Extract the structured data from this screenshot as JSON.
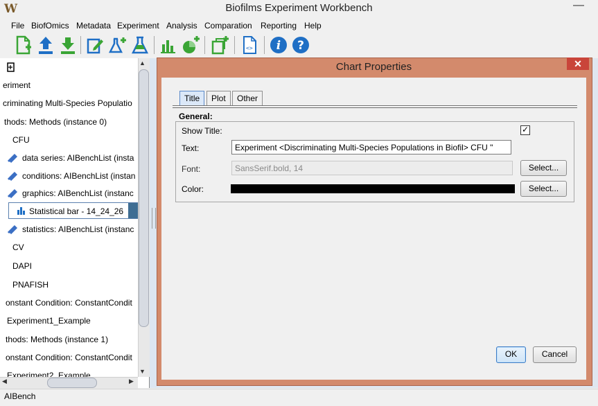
{
  "window": {
    "title": "Biofilms Experiment Workbench",
    "icon": "app-logo-icon",
    "minimize_glyph": "—"
  },
  "menu": [
    "File",
    "BiofOmics",
    "Metadata",
    "Experiment",
    "Analysis",
    "Comparation",
    "Reporting",
    "Help"
  ],
  "toolbar": {
    "icons": [
      "new-document-icon",
      "upload-icon",
      "download-icon",
      "edit-icon",
      "add-experiment-icon",
      "experiment-flask-icon",
      "bar-chart-icon",
      "add-pie-chart-icon",
      "add-copy-icon",
      "xml-file-icon",
      "info-icon",
      "help-icon"
    ],
    "colors": {
      "green": "#3aa535",
      "blue": "#1f6fc5"
    }
  },
  "tree": {
    "items": [
      {
        "label": "",
        "icon": "root-icon"
      },
      {
        "label": "eriment",
        "icon": ""
      },
      {
        "label": "criminating Multi-Species Populatio",
        "icon": ""
      },
      {
        "label": "thods: Methods (instance 0)",
        "icon": ""
      },
      {
        "label": "CFU",
        "icon": ""
      },
      {
        "label": "data series: AIBenchList (insta",
        "icon": "link-icon"
      },
      {
        "label": "conditions: AIBenchList (instan",
        "icon": "link-icon"
      },
      {
        "label": "graphics: AIBenchList (instanc",
        "icon": "link-icon"
      },
      {
        "label": "Statistical bar - 14_24_26",
        "icon": "bar-chart-icon",
        "selected": true
      },
      {
        "label": "statistics: AIBenchList (instanc",
        "icon": "link-icon"
      },
      {
        "label": "CV",
        "icon": ""
      },
      {
        "label": "DAPI",
        "icon": ""
      },
      {
        "label": "PNAFISH",
        "icon": ""
      },
      {
        "label": "onstant Condition: ConstantCondit",
        "icon": ""
      },
      {
        "label": "Experiment1_Example",
        "icon": ""
      },
      {
        "label": "thods: Methods (instance 1)",
        "icon": ""
      },
      {
        "label": "onstant Condition: ConstantCondit",
        "icon": ""
      },
      {
        "label": "Experiment2_Example",
        "icon": ""
      }
    ]
  },
  "dialog": {
    "title": "Chart Properties",
    "close_glyph": "✕",
    "tabs": [
      "Title",
      "Plot",
      "Other"
    ],
    "active_tab": "Title",
    "section": "General:",
    "show_title_label": "Show Title:",
    "show_title_checked": true,
    "text_label": "Text:",
    "text_value": "Experiment <Discriminating Multi-Species Populations in Biofil> CFU \"",
    "font_label": "Font:",
    "font_value": "SansSerif.bold, 14",
    "color_label": "Color:",
    "color_value": "#000000",
    "select_label": "Select...",
    "ok_label": "OK",
    "cancel_label": "Cancel"
  },
  "status": {
    "text": "AIBench"
  }
}
